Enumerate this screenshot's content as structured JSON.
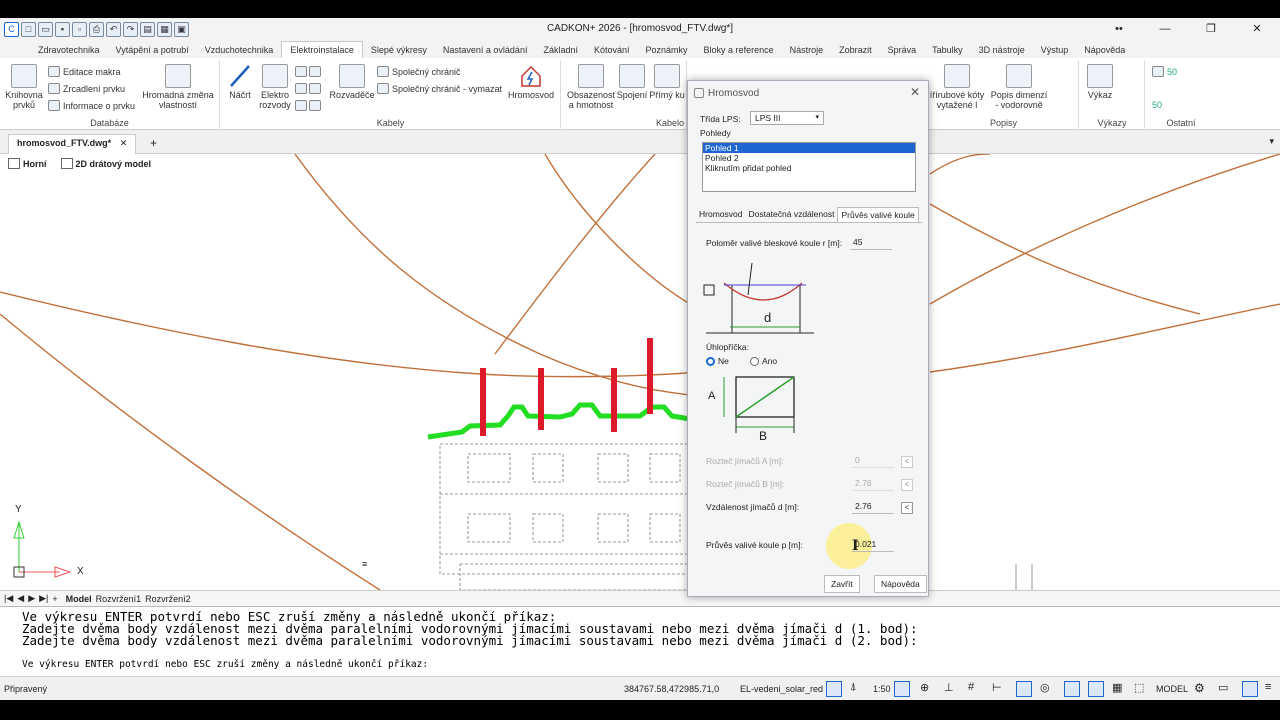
{
  "window": {
    "title": "CADKON+ 2026 - [hromosvod_FTV.dwg*]",
    "controls": {
      "more": "••",
      "minimize": "—",
      "restore": "❐",
      "close": "✕"
    }
  },
  "menu_tabs": [
    "Zdravotechnika",
    "Vytápění a potrubí",
    "Vzduchotechnika",
    "Elektroinstalace",
    "Slepé výkresy",
    "Nastavení a ovládání",
    "Základní",
    "Kótování",
    "Poznámky",
    "Bloky a reference",
    "Nástroje",
    "Zobrazit",
    "Správa",
    "Tabulky",
    "3D nástroje",
    "Výstup",
    "Nápověda"
  ],
  "active_tab": "Elektroinstalace",
  "ribbon": {
    "knihovna": "Knihovna\nprvků",
    "editace_makra": "Editace makra",
    "zrcadleni": "Zrcadlení prvku",
    "informace": "Informace o prvku",
    "hromadna": "Hromadná změna\nvlastností",
    "databaze": "Databáze",
    "nacrt": "Náčrt",
    "elektro_rozvody": "Elektro\nrozvody",
    "rozvadece": "Rozvaděče",
    "spolecny": "Společný chránič",
    "spolecny_vymazat": "Společný chránič - vymazat",
    "kabely": "Kabely",
    "hromosvod": "Hromosvod",
    "obsazenost": "Obsazenost\na hmotnost",
    "spojeni": "Spojení",
    "primy": "Přímý ku",
    "kabelo": "Kabelo",
    "prirubove": "ířírubové kóty\nvytažené l",
    "popis_dimenzi": "Popis dimenzí\n- vodorovně",
    "popisy": "Popisy",
    "vykaz": "Výkaz",
    "vykazy": "Výkazy",
    "ostatni": "Ostatní",
    "num50a": "50",
    "num50b": "50"
  },
  "document_tab": "hromosvod_FTV.dwg*",
  "view": {
    "horni": "Horní",
    "model": "2D drátový model"
  },
  "axes": {
    "x": "X",
    "y": "Y"
  },
  "layout_tabs": [
    "Model",
    "Rozvržení1",
    "Rozvržení2"
  ],
  "command_lines": [
    "Ve výkresu ENTER potvrdí nebo ESC zruší změny a následně ukončí příkaz:",
    "Zadejte dvěma body vzdálenost mezi dvěma paralelními vodorovnými jímacími soustavami nebo mezi dvěma jímači d (1. bod):",
    "Zadejte dvěma body vzdálenost mezi dvěma paralelními vodorovnými jímacími soustavami nebo mezi dvěma jímači d (2. bod):"
  ],
  "command_prompt": "Ve výkresu ENTER potvrdí nebo ESC zruší změny a následně ukončí příkaz:",
  "status": {
    "ready": "Připravený",
    "coords": "384767.58,472985.71,0",
    "layer": "EL-vedeni_solar_red",
    "scale": "1:50",
    "model": "MODEL"
  },
  "dialog": {
    "title": "Hromosvod",
    "lps_label": "Třída LPS:",
    "lps_value": "LPS III",
    "views_label": "Pohledy",
    "views": [
      "Pohled 1",
      "Pohled 2",
      "Kliknutím přidat pohled"
    ],
    "tabs": [
      "Hromosvod",
      "Dostatečná vzdálenost",
      "Průvěs valivé koule"
    ],
    "active_tab": "Průvěs valivé koule",
    "radius_label": "Poloměr valivé bleskové koule r [m]:",
    "radius_value": "45",
    "diagonal_label": "Úhlopříčka:",
    "opt_no": "Ne",
    "opt_yes": "Ano",
    "spacing_a_label": "Rozteč jímačů A [m]:",
    "spacing_a_value": "0",
    "spacing_b_label": "Rozteč jímačů B [m]:",
    "spacing_b_value": "2.76",
    "distance_label": "Vzdálenost jímačů d [m]:",
    "distance_value": "2.76",
    "sag_label": "Průvěs valivé koule p [m]:",
    "sag_value": "0.021",
    "close_btn": "Zavřít",
    "help_btn": "Nápověda",
    "pick": "<",
    "diag_labels": {
      "d": "d",
      "A": "A",
      "B": "B"
    }
  },
  "colors": {
    "accent": "#1e66d0",
    "arc": "#c0703a",
    "green": "#22dd22",
    "red": "#dd1a2a"
  }
}
